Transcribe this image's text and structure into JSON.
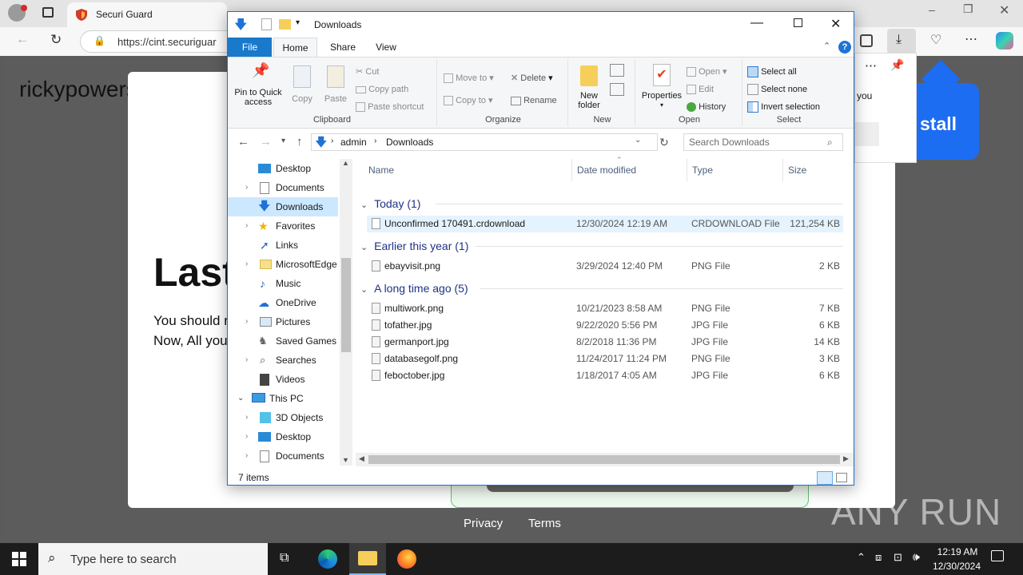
{
  "browser": {
    "tab_title": "Securi Guard",
    "url": "https://cint.securiguar"
  },
  "webpage": {
    "heading_left": "rickypowersports",
    "big_title": "Last",
    "body_line1": "You should r",
    "body_line2": "Now, All you",
    "popup_text": "you",
    "install_label": "stall",
    "footer_privacy": "Privacy",
    "footer_terms": "Terms",
    "watermark": "ANY RUN"
  },
  "explorer": {
    "title": "Downloads",
    "ribbon_tabs": [
      "File",
      "Home",
      "Share",
      "View"
    ],
    "clipboard": {
      "pin_line1": "Pin to Quick",
      "pin_line2": "access",
      "copy": "Copy",
      "paste": "Paste",
      "cut": "Cut",
      "copy_path": "Copy path",
      "paste_shortcut": "Paste shortcut",
      "label": "Clipboard"
    },
    "organize": {
      "move_to": "Move to",
      "copy_to": "Copy to",
      "delete": "Delete",
      "rename": "Rename",
      "label": "Organize"
    },
    "new": {
      "new_folder_line1": "New",
      "new_folder_line2": "folder",
      "label": "New"
    },
    "open": {
      "properties": "Properties",
      "open": "Open",
      "edit": "Edit",
      "history": "History",
      "label": "Open"
    },
    "select": {
      "select_all": "Select all",
      "select_none": "Select none",
      "invert": "Invert selection",
      "label": "Select"
    },
    "breadcrumb": [
      "admin",
      "Downloads"
    ],
    "search_placeholder": "Search Downloads",
    "nav": [
      "Desktop",
      "Documents",
      "Downloads",
      "Favorites",
      "Links",
      "MicrosoftEdge",
      "Music",
      "OneDrive",
      "Pictures",
      "Saved Games",
      "Searches",
      "Videos",
      "This PC",
      "3D Objects",
      "Desktop",
      "Documents"
    ],
    "columns": [
      "Name",
      "Date modified",
      "Type",
      "Size"
    ],
    "groups": [
      {
        "title": "Today (1)",
        "files": [
          {
            "name": "Unconfirmed 170491.crdownload",
            "date": "12/30/2024 12:19 AM",
            "type": "CRDOWNLOAD File",
            "size": "121,254 KB"
          }
        ]
      },
      {
        "title": "Earlier this year (1)",
        "files": [
          {
            "name": "ebayvisit.png",
            "date": "3/29/2024 12:40 PM",
            "type": "PNG File",
            "size": "2 KB"
          }
        ]
      },
      {
        "title": "A long time ago (5)",
        "files": [
          {
            "name": "multiwork.png",
            "date": "10/21/2023 8:58 AM",
            "type": "PNG File",
            "size": "7 KB"
          },
          {
            "name": "tofather.jpg",
            "date": "9/22/2020 5:56 PM",
            "type": "JPG File",
            "size": "6 KB"
          },
          {
            "name": "germanport.jpg",
            "date": "8/2/2018 11:36 PM",
            "type": "JPG File",
            "size": "14 KB"
          },
          {
            "name": "databasegolf.png",
            "date": "11/24/2017 11:24 PM",
            "type": "PNG File",
            "size": "3 KB"
          },
          {
            "name": "feboctober.jpg",
            "date": "1/18/2017 4:05 AM",
            "type": "JPG File",
            "size": "6 KB"
          }
        ]
      }
    ],
    "status": "7 items"
  },
  "taskbar": {
    "search_placeholder": "Type here to search",
    "time": "12:19 AM",
    "date": "12/30/2024"
  }
}
